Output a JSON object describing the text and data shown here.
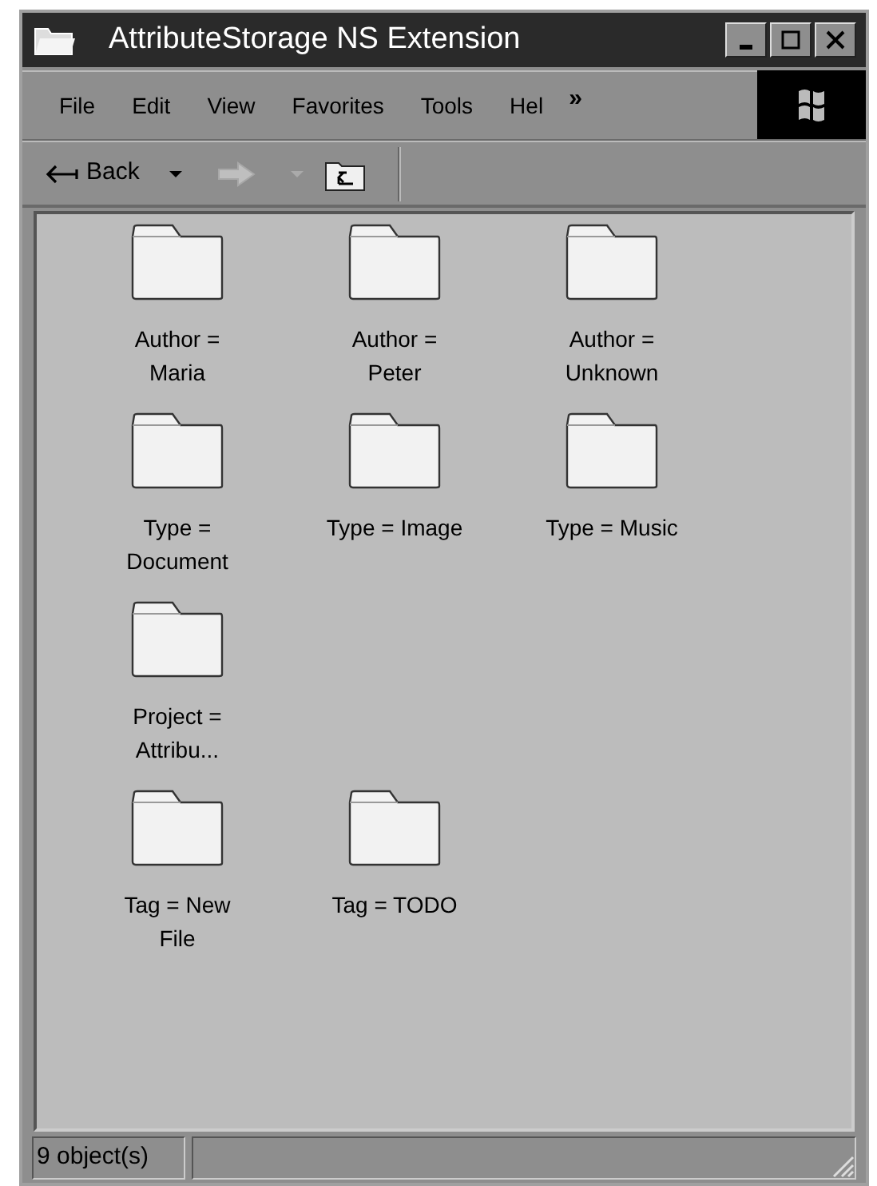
{
  "window": {
    "title": "AttributeStorage NS Extension"
  },
  "menu": [
    "File",
    "Edit",
    "View",
    "Favorites",
    "Tools",
    "Hel"
  ],
  "menu_overflow": "»",
  "toolbar": {
    "back": {
      "label": "Back",
      "disabled": false
    },
    "forward": {
      "disabled": true
    }
  },
  "folder_rows": [
    [
      {
        "label": "Author = Maria"
      },
      {
        "label": "Author = Peter"
      },
      {
        "label": "Author = Unknown"
      }
    ],
    [
      {
        "label": "Type = Document"
      },
      {
        "label": "Type = Image"
      },
      {
        "label": "Type = Music"
      }
    ],
    [
      {
        "label": "Project = Attribu..."
      }
    ],
    [
      {
        "label": "Tag = New File"
      },
      {
        "label": "Tag = TODO"
      }
    ]
  ],
  "status_bar": {
    "text": "9 object(s)"
  }
}
